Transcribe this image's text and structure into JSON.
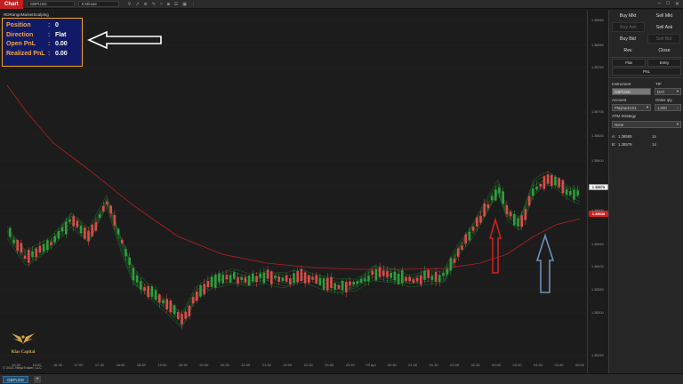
{
  "topbar": {
    "chart_tab": "Chart",
    "instrument": "GBPUSD",
    "interval": "5 Minute",
    "icons": [
      "search-icon",
      "pointer-icon",
      "magnify-icon",
      "draw-icon",
      "indicator-icon",
      "strategy-icon",
      "properties-icon",
      "camera-icon",
      "more-icon"
    ],
    "window_buttons": [
      "minimize-icon",
      "maximize-icon",
      "close-icon"
    ]
  },
  "chart": {
    "strategy_label": "RDRangeMarketScalping",
    "pnl_box": {
      "rows": [
        {
          "key": "Position",
          "value": "0"
        },
        {
          "key": "Direction",
          "value": "Flat"
        },
        {
          "key": "Open PnL",
          "value": "0.00"
        },
        {
          "key": "Realized PnL",
          "value": "0.00"
        }
      ]
    },
    "logo_text": "Klas Capital",
    "copyright": "© 2021 NinjaTrader, LLC",
    "price_ticks": [
      "1.38950",
      "1.38850",
      "1.38750",
      "1.38700",
      "1.38650",
      "1.38600",
      "1.38550",
      "1.38500",
      "1.38450",
      "1.38400",
      "1.38350",
      "1.38300",
      "1.38250"
    ],
    "price_marker_current": "1.38579",
    "price_marker_ma": "1.38538",
    "time_ticks": [
      "15:30",
      "16:00",
      "16:30",
      "17:00",
      "17:30",
      "18:00",
      "18:30",
      "19:00",
      "19:30",
      "20:00",
      "20:30",
      "21:00",
      "21:30",
      "22:00",
      "22:30",
      "23:00",
      "23:30",
      "03 Apr",
      "00:30",
      "01:00",
      "01:30",
      "02:00",
      "02:30",
      "03:00",
      "03:30",
      "04:00",
      "04:30",
      "05:00"
    ],
    "colors": {
      "bull": "#2e9e3e",
      "bear": "#e04a4a",
      "ma": "#b52020",
      "ribbon": "#1f6b2a",
      "arrow_white": "#ffffff",
      "arrow_red": "#d01e1e",
      "arrow_blue": "#6d8fb5"
    }
  },
  "right_panel": {
    "buy_mkt": "Buy Mkt",
    "sell_mkt": "Sell Mkt",
    "buy_ask": "Buy Ask",
    "sell_ask": "Sell Ask",
    "buy_bid": "Buy Bid",
    "sell_bid": "Sell Bid",
    "rev": "Rev",
    "close": "Close",
    "flat": "Flat",
    "entry": "Entry",
    "pnl": "PnL",
    "instrument_label": "Instrument",
    "instrument_value": "GBPUSD",
    "tif_label": "TIF",
    "tif_value": "DAY",
    "account_label": "Account",
    "account_value": "Playback101",
    "order_qty_label": "Order qty",
    "order_qty_value": "1,000",
    "atm_label": "ATM Strategy",
    "atm_value": "None",
    "ask_label": "A:",
    "ask_price": "1.38589",
    "ask_size": "14",
    "bid_label": "B:",
    "bid_price": "1.38579",
    "bid_size": "14"
  },
  "bottombar": {
    "tab_label": "GBPUSD",
    "add_label": "+"
  }
}
